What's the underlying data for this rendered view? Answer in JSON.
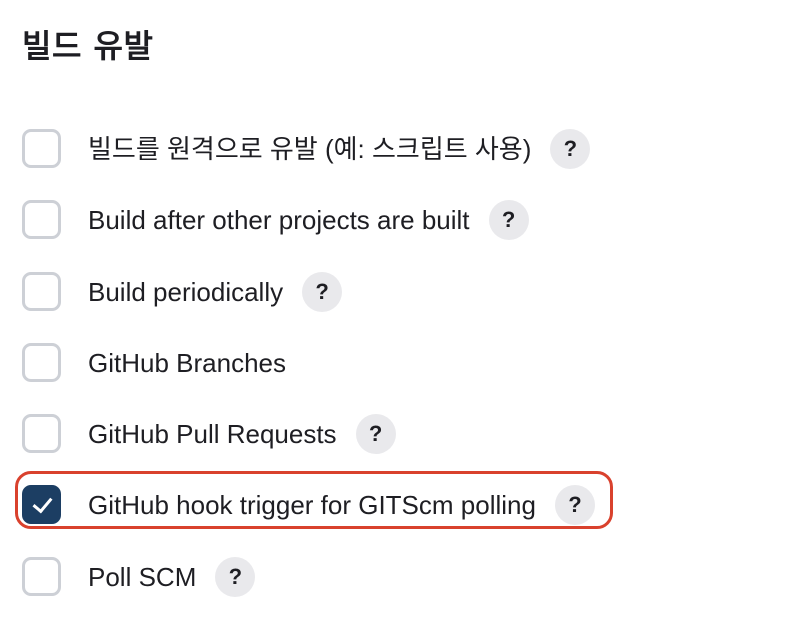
{
  "section": {
    "title": "빌드 유발"
  },
  "help_label": "?",
  "highlight_color": "#d9412d",
  "checkbox_checked_color": "#1c3e63",
  "triggers": [
    {
      "label": "빌드를 원격으로 유발 (예: 스크립트 사용)",
      "checked": false,
      "has_help": true
    },
    {
      "label": "Build after other projects are built",
      "checked": false,
      "has_help": true
    },
    {
      "label": "Build periodically",
      "checked": false,
      "has_help": true
    },
    {
      "label": "GitHub Branches",
      "checked": false,
      "has_help": false
    },
    {
      "label": "GitHub Pull Requests",
      "checked": false,
      "has_help": true
    },
    {
      "label": "GitHub hook trigger for GITScm polling",
      "checked": true,
      "has_help": true,
      "highlighted": true
    },
    {
      "label": "Poll SCM",
      "checked": false,
      "has_help": true
    }
  ]
}
